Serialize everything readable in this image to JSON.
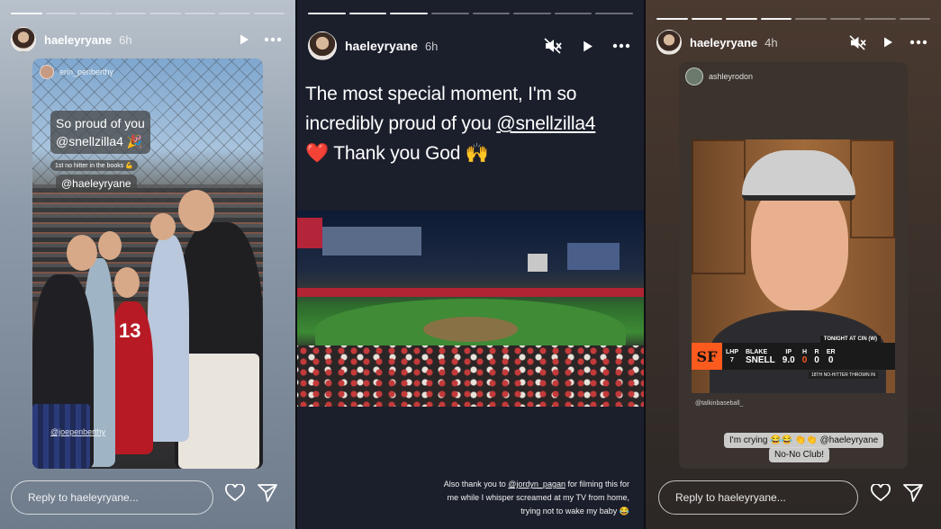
{
  "stories": [
    {
      "progress_segments": 8,
      "progress_done": 1,
      "username": "haeleyryane",
      "time_ago": "6h",
      "photo_tag": "erin_penberthy",
      "sticker_main": "So proud of you\n@snellzilla4 🎉",
      "sticker_small": "1st no hitter in the books 💪",
      "sticker_mention": "@haeleyryane",
      "jersey_number": "13",
      "photo_credit": "@joepenberthy",
      "reply_placeholder": "Reply to haeleyryane..."
    },
    {
      "progress_segments": 8,
      "progress_done": 3,
      "username": "haeleyryane",
      "time_ago": "6h",
      "message_before": "The most special moment, I'm so incredibly proud of you ",
      "message_mention": "@snellzilla4",
      "message_after": " ❤️ Thank you God 🙌",
      "caption_before": "Also thank you to ",
      "caption_mention": "@jordyn_pagan",
      "caption_after": " for filming this for me while I whisper screamed at my TV from home, trying not to wake my baby 😂"
    },
    {
      "progress_segments": 8,
      "progress_done": 4,
      "username": "haeleyryane",
      "time_ago": "4h",
      "shared_from": "ashleyrodon",
      "score_header": "TONIGHT AT CIN (W)",
      "score_team": "SF",
      "score_hand": "LHP",
      "score_number": "7",
      "score_name_first": "BLAKE",
      "score_name_last": "SNELL",
      "score_stats_labels": [
        "IP",
        "H",
        "R",
        "ER"
      ],
      "score_stats_values": [
        "9.0",
        "0",
        "0",
        "0"
      ],
      "score_footnote": "18TH NO-HITTER THROWN IN",
      "video_credit": "@talkinbaseball_",
      "sticker_crying": "I'm crying 😂😂 👏👏 @haeleyryane",
      "sticker_club": "No-No Club!",
      "reply_placeholder": "Reply to haeleyryane..."
    }
  ],
  "icons": {
    "play": "play-icon",
    "more": "more-dots-icon",
    "mute": "speaker-muted-icon",
    "like": "heart-outline-icon",
    "share": "paper-plane-icon"
  }
}
